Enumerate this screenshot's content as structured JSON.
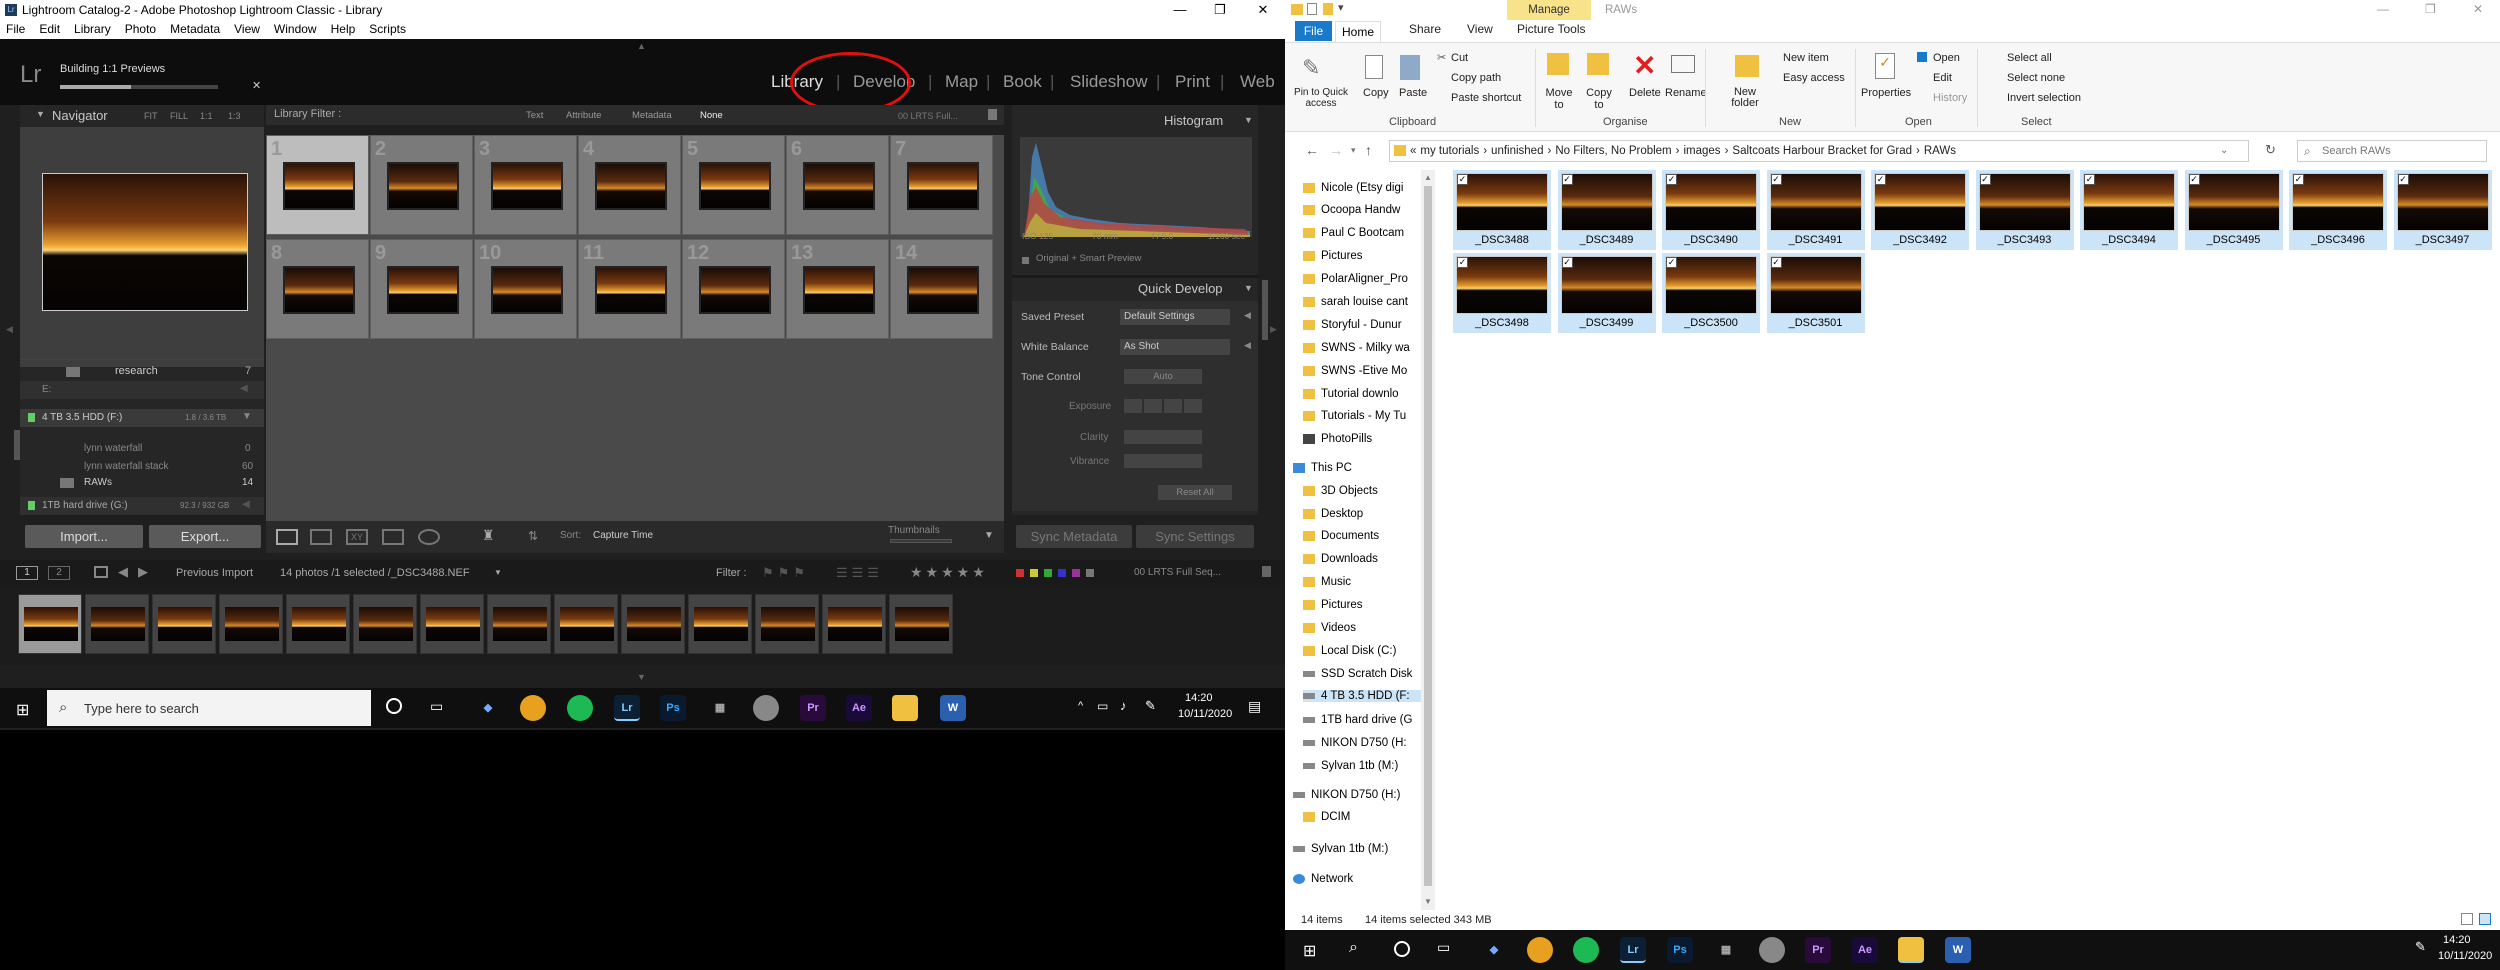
{
  "lr": {
    "title": "Lightroom Catalog-2 - Adobe Photoshop Lightroom Classic - Library",
    "menu": [
      "File",
      "Edit",
      "Library",
      "Photo",
      "Metadata",
      "View",
      "Window",
      "Help",
      "Scripts"
    ],
    "logo": "Lr",
    "status": "Building 1:1 Previews",
    "modules": [
      "Library",
      "Develop",
      "Map",
      "Book",
      "Slideshow",
      "Print",
      "Web"
    ],
    "navigator": {
      "title": "Navigator",
      "zoom": [
        "FIT",
        "FILL",
        "1:1",
        "1:3"
      ]
    },
    "filter": {
      "title": "Library Filter :",
      "options": [
        "Text",
        "Attribute",
        "Metadata",
        "None"
      ],
      "preset": "00 LRTS Full..."
    },
    "histogram": {
      "title": "Histogram",
      "iso": "ISO 125",
      "focal": "70 mm",
      "aperture": "f / 9.0",
      "shutter": "1/160 sec",
      "preview": "Original + Smart Preview"
    },
    "quick_develop": {
      "title": "Quick Develop",
      "saved_preset_label": "Saved Preset",
      "saved_preset": "Default Settings",
      "wb_label": "White Balance",
      "wb": "As Shot",
      "tone_label": "Tone Control",
      "auto": "Auto",
      "exposure": "Exposure",
      "clarity": "Clarity",
      "vibrance": "Vibrance",
      "reset": "Reset All"
    },
    "folders": {
      "research": "research",
      "research_count": "7",
      "e_drive": "E:",
      "hdd": "4 TB 3.5 HDD (F:)",
      "hdd_size": "1.8 / 3.6 TB",
      "f1": "lynn waterfall",
      "f1c": "0",
      "f2": "lynn waterfall stack",
      "f2c": "60",
      "f3": "RAWs",
      "f3c": "14",
      "hd1": "1TB hard drive (G:)",
      "hd1_size": "92.3 / 932 GB"
    },
    "import": "Import...",
    "export": "Export...",
    "sort_label": "Sort:",
    "sort": "Capture Time",
    "thumbnails": "Thumbnails",
    "sync_meta": "Sync Metadata",
    "sync_settings": "Sync Settings",
    "grid_numbers": [
      "1",
      "2",
      "3",
      "4",
      "5",
      "6",
      "7",
      "8",
      "9",
      "10",
      "11",
      "12",
      "13",
      "14"
    ],
    "filmstrip": {
      "page1": "1",
      "page2": "2",
      "source": "Previous Import",
      "info": "14 photos /1 selected /_DSC3488.NEF",
      "filter": "Filter :",
      "preset": "00 LRTS Full Seq..."
    }
  },
  "taskbar_left": {
    "search": "Type here to search",
    "time": "14:20",
    "date": "10/11/2020"
  },
  "explorer": {
    "title": "RAWs",
    "manage": "Manage",
    "picture_tools": "Picture Tools",
    "tabs": [
      "File",
      "Home",
      "Share",
      "View"
    ],
    "ribbon": {
      "pin": "Pin to Quick access",
      "copy": "Copy",
      "paste": "Paste",
      "cut": "Cut",
      "copy_path": "Copy path",
      "paste_shortcut": "Paste shortcut",
      "clipboard": "Clipboard",
      "move_to": "Move to",
      "copy_to": "Copy to",
      "delete": "Delete",
      "rename": "Rename",
      "organise": "Organise",
      "new_folder": "New folder",
      "new_item": "New item",
      "easy_access": "Easy access",
      "new": "New",
      "properties": "Properties",
      "open": "Open",
      "edit": "Edit",
      "history": "History",
      "open_grp": "Open",
      "select_all": "Select all",
      "select_none": "Select none",
      "invert": "Invert selection",
      "select": "Select"
    },
    "breadcrumb": [
      "«",
      "my tutorials",
      "unfinished",
      "No Filters, No Problem",
      "images",
      "Saltcoats Harbour Bracket for Grad",
      "RAWs"
    ],
    "search_placeholder": "Search RAWs",
    "tree": [
      "Nicole (Etsy digi",
      "Ocoopa Handw",
      "Paul C Bootcam",
      "Pictures",
      "PolarAligner_Pro",
      "sarah louise cant",
      "Storyful - Dunur",
      "SWNS - Milky wa",
      "SWNS -Etive Mo",
      "Tutorial downlo",
      "Tutorials - My Tu",
      "PhotoPills",
      "This PC",
      "3D Objects",
      "Desktop",
      "Documents",
      "Downloads",
      "Music",
      "Pictures",
      "Videos",
      "Local Disk (C:)",
      "SSD Scratch Disk",
      "4 TB 3.5 HDD (F:",
      "1TB hard drive (G",
      "NIKON D750 (H:",
      "Sylvan 1tb (M:)",
      "NIKON D750 (H:)",
      "DCIM",
      "Sylvan 1tb (M:)",
      "Network"
    ],
    "files": [
      "_DSC3488",
      "_DSC3489",
      "_DSC3490",
      "_DSC3491",
      "_DSC3492",
      "_DSC3493",
      "_DSC3494",
      "_DSC3495",
      "_DSC3496",
      "_DSC3497",
      "_DSC3498",
      "_DSC3499",
      "_DSC3500",
      "_DSC3501"
    ],
    "status_items": "14 items",
    "status_selected": "14 items selected  343 MB"
  },
  "taskbar_right": {
    "time": "14:20",
    "date": "10/11/2020"
  }
}
